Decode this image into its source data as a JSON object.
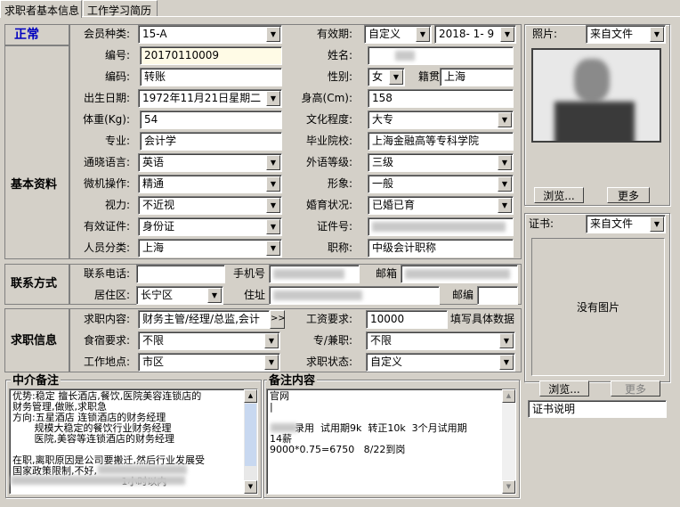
{
  "tabs": [
    {
      "label": "求职者基本信息"
    },
    {
      "label": "工作学习简历"
    }
  ],
  "status": "正常",
  "sections": {
    "basic": "基本资料",
    "contact": "联系方式",
    "job": "求职信息"
  },
  "basic": {
    "member_type": {
      "label": "会员种类:",
      "value": "15-A"
    },
    "valid": {
      "label": "有效期:",
      "mode": "自定义",
      "date": "2018- 1- 9"
    },
    "number": {
      "label": "编号:",
      "value": "20170110009"
    },
    "name": {
      "label": "姓名:"
    },
    "code": {
      "label": "编码:",
      "value": "转账"
    },
    "gender": {
      "label": "性别:",
      "value": "女"
    },
    "origin": {
      "label": "籍贯",
      "value": "上海"
    },
    "birth": {
      "label": "出生日期:",
      "value": "1972年11月21日星期二"
    },
    "height": {
      "label": "身高(Cm):",
      "value": "158"
    },
    "weight": {
      "label": "体重(Kg):",
      "value": "54"
    },
    "education": {
      "label": "文化程度:",
      "value": "大专"
    },
    "major": {
      "label": "专业:",
      "value": "会计学"
    },
    "school": {
      "label": "毕业院校:",
      "value": "上海金融高等专科学院"
    },
    "language": {
      "label": "通晓语言:",
      "value": "英语"
    },
    "lang_level": {
      "label": "外语等级:",
      "value": "三级"
    },
    "computer": {
      "label": "微机操作:",
      "value": "精通"
    },
    "appearance": {
      "label": "形象:",
      "value": "一般"
    },
    "vision": {
      "label": "视力:",
      "value": "不近视"
    },
    "marital": {
      "label": "婚育状况:",
      "value": "已婚已育"
    },
    "id_type": {
      "label": "有效证件:",
      "value": "身份证"
    },
    "id_no": {
      "label": "证件号:"
    },
    "category": {
      "label": "人员分类:",
      "value": "上海"
    },
    "title": {
      "label": "职称:",
      "value": "中级会计职称"
    }
  },
  "contact": {
    "phone": {
      "label": "联系电话:"
    },
    "mobile": {
      "label": "手机号"
    },
    "email": {
      "label": "邮箱"
    },
    "district": {
      "label": "居住区:",
      "value": "长宁区"
    },
    "address": {
      "label": "住址"
    },
    "zip": {
      "label": "邮编"
    }
  },
  "job": {
    "content": {
      "label": "求职内容:",
      "value": "财务主管/经理/总监,会计",
      "more": ">>"
    },
    "salary": {
      "label": "工资要求:",
      "value": "10000",
      "hint": "填写具体数据"
    },
    "board": {
      "label": "食宿要求:",
      "value": "不限"
    },
    "fulltime": {
      "label": "专/兼职:",
      "value": "不限"
    },
    "location": {
      "label": "工作地点:",
      "value": "市区"
    },
    "state": {
      "label": "求职状态:",
      "value": "自定义"
    }
  },
  "photo": {
    "label": "照片:",
    "source": "来自文件",
    "browse": "浏览...",
    "more": "更多"
  },
  "cert": {
    "label": "证书:",
    "source": "来自文件",
    "empty": "没有图片",
    "browse": "浏览...",
    "more": "更多",
    "desc": "证书说明"
  },
  "agency_notes": {
    "title": "中介备注",
    "text": "优势:稳定 擅长酒店,餐饮,医院美容连锁店的\n财务管理,做账,求职急\n方向:五星酒店 连锁酒店的财务经理\n       规模大稳定的餐饮行业财务经理\n       医院,美容等连锁酒店的财务经理\n\n在职,离职原因是公司要搬迁,然后行业发展受\n国家政策限制,不好,\n                                   1小时以内"
  },
  "remarks": {
    "title": "备注内容",
    "text": "官网\n|\n\n        录用  试用期9k  转正10k  3个月试用期\n14薪\n9000*0.75=6750   8/22到岗"
  },
  "colors": {
    "status": "#0000c0",
    "highlight": "#fffbe6"
  }
}
